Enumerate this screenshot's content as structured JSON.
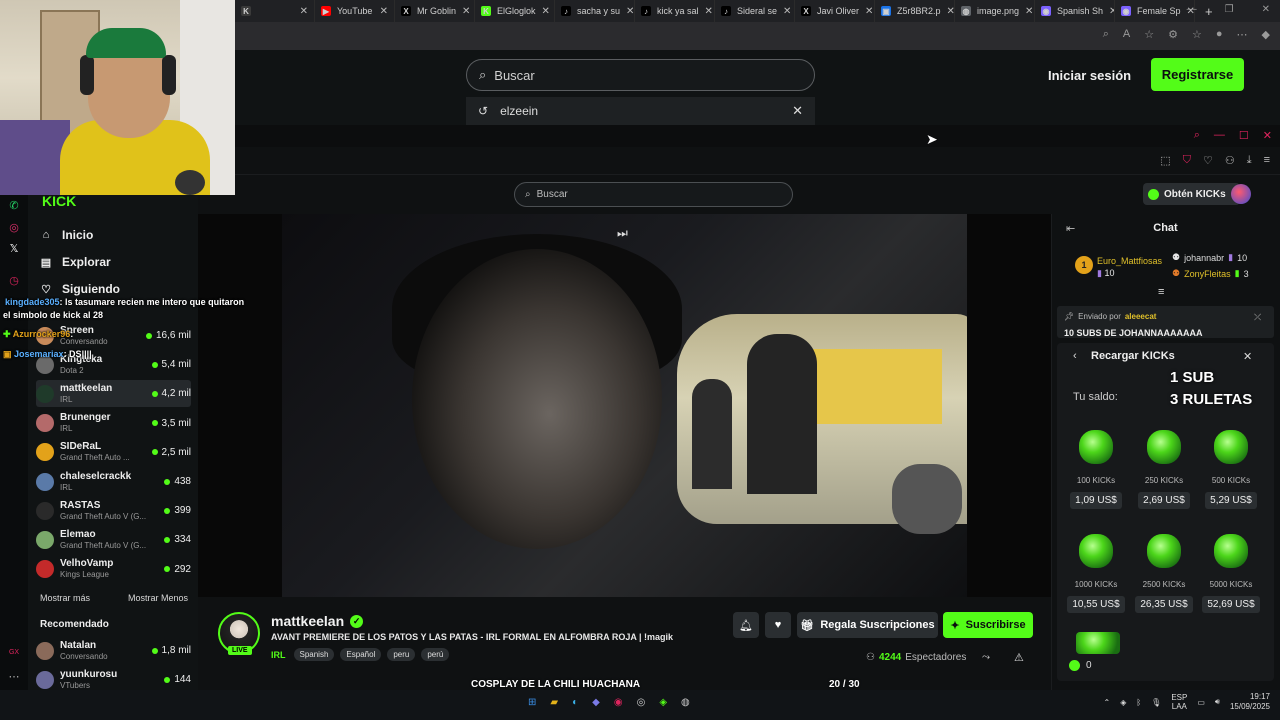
{
  "browser": {
    "tabs": [
      {
        "title": "",
        "color": "#3a3a3a",
        "glyph": "K"
      },
      {
        "title": "YouTube",
        "color": "#ff0000",
        "glyph": "▶"
      },
      {
        "title": "Mr Goblin",
        "color": "#000000",
        "glyph": "X"
      },
      {
        "title": "ElGloglok",
        "color": "#53fc18",
        "glyph": "K"
      },
      {
        "title": "sacha y su",
        "color": "#000000",
        "glyph": "♪"
      },
      {
        "title": "kick ya sal",
        "color": "#000000",
        "glyph": "♪"
      },
      {
        "title": "Sideral se",
        "color": "#000000",
        "glyph": "♪"
      },
      {
        "title": "Javi Oliver",
        "color": "#000000",
        "glyph": "X"
      },
      {
        "title": "Z5r8BR2.p",
        "color": "#1a73e8",
        "glyph": "▣"
      },
      {
        "title": "image.png",
        "color": "#5f6368",
        "glyph": "◍"
      },
      {
        "title": "Spanish Sh",
        "color": "#7b61ff",
        "glyph": "◉"
      },
      {
        "title": "Female Sp",
        "color": "#7b61ff",
        "glyph": "◉"
      }
    ],
    "new_tab": "+"
  },
  "outer_page": {
    "search_placeholder": "Buscar",
    "suggestion": "elzeein",
    "login_label": "Iniciar sesión",
    "register_label": "Registrarse"
  },
  "inner_header": {
    "search_placeholder": "Buscar",
    "kicks_button": "Obtén KICKs"
  },
  "sidebar": {
    "nav": [
      {
        "label": "Inicio",
        "icon": "home-icon",
        "glyph": "⌂"
      },
      {
        "label": "Explorar",
        "icon": "explore-icon",
        "glyph": "▤"
      },
      {
        "label": "Siguiendo",
        "icon": "heart-icon",
        "glyph": "♡"
      }
    ],
    "following": [
      {
        "name": "Spreen",
        "category": "Conversando",
        "viewers": "16,6 mil",
        "color": "#c98b5a"
      },
      {
        "name": "Kingteka",
        "category": "Dota 2",
        "viewers": "5,4 mil",
        "color": "#6a6a6a"
      },
      {
        "name": "mattkeelan",
        "category": "IRL",
        "viewers": "4,2 mil",
        "color": "#1f3a2a"
      },
      {
        "name": "Brunenger",
        "category": "IRL",
        "viewers": "3,5 mil",
        "color": "#b46a6a"
      },
      {
        "name": "SIDeRaL",
        "category": "Grand Theft Auto ...",
        "viewers": "2,5 mil",
        "color": "#e3a21a"
      },
      {
        "name": "chaleselcrackk",
        "category": "IRL",
        "viewers": "438",
        "color": "#5a7aa8"
      },
      {
        "name": "RASTAS",
        "category": "Grand Theft Auto V (G...",
        "viewers": "399",
        "color": "#2a2a2a"
      },
      {
        "name": "Elemao",
        "category": "Grand Theft Auto V (G...",
        "viewers": "334",
        "color": "#7aa86a"
      },
      {
        "name": "VelhoVamp",
        "category": "Kings League",
        "viewers": "292",
        "color": "#c42a2a"
      }
    ],
    "show_more": "Mostrar más",
    "show_less": "Mostrar Menos",
    "recommended_title": "Recomendado",
    "recommended": [
      {
        "name": "Natalan",
        "category": "Conversando",
        "viewers": "1,8 mil",
        "color": "#8a6a5a"
      },
      {
        "name": "yuunkurosu",
        "category": "VTubers",
        "viewers": "144",
        "color": "#6a6a9a"
      }
    ]
  },
  "overlay_chat": [
    {
      "user": "kingdade305",
      "text": ": ls tasumare recien me intero que quitaron"
    },
    {
      "user": "",
      "text": "el simbolo de kick al 28"
    },
    {
      "user": "Azurrocker96",
      "text": ":"
    },
    {
      "user": "Josemariax",
      "text": ": DS||||"
    }
  ],
  "stream": {
    "streamer": "mattkeelan",
    "live_label": "LIVE",
    "title": "AVANT PREMIERE DE LOS PATOS Y LAS PATAS - IRL FORMAL EN ALFOMBRA ROJA | !magik",
    "category": "IRL",
    "tags": [
      "Spanish",
      "Español",
      "peru",
      "perú"
    ],
    "gift_label": "Regala Suscripciones",
    "subscribe_label": "Suscribirse",
    "viewer_count": "4244",
    "viewer_label": "Espectadores"
  },
  "goal": {
    "label": "COSPLAY DE LA CHILI HUACHANA",
    "current": "20",
    "sep": "/",
    "total": "30",
    "progress": 0.67
  },
  "chat": {
    "title": "Chat",
    "leaderboard": [
      {
        "rank": "1",
        "name": "Euro_Mattfiosas",
        "value": "10",
        "name_color": "#e0c02a"
      },
      {
        "name": "johannabr",
        "value": "10",
        "name_color": "#dddddd"
      },
      {
        "name": "ZonyFleitas",
        "value": "3",
        "name_color": "#e0c02a"
      }
    ],
    "pinned_by_label": "Enviado por",
    "pinned_by_user": "aleeecat",
    "pinned_message": "10 SUBS DE JOHANNAAAAAAA"
  },
  "recharge": {
    "title": "Recargar KICKs",
    "balance_label": "Tu saldo:",
    "promo_line1": "1 SUB",
    "promo_line2": "3 RULETAS",
    "packs": [
      {
        "amount": "100 KICKs",
        "price": "1,09 US$"
      },
      {
        "amount": "250 KICKs",
        "price": "2,69 US$"
      },
      {
        "amount": "500 KICKs",
        "price": "5,29 US$"
      },
      {
        "amount": "1000 KICKs",
        "price": "10,55 US$"
      },
      {
        "amount": "2500 KICKs",
        "price": "26,35 US$"
      },
      {
        "amount": "5000 KICKs",
        "price": "52,69 US$"
      }
    ],
    "kick_balance": "0"
  },
  "taskbar": {
    "lang_top": "ESP",
    "lang_bottom": "LAA",
    "time": "19:17",
    "date": "15/09/2025"
  }
}
